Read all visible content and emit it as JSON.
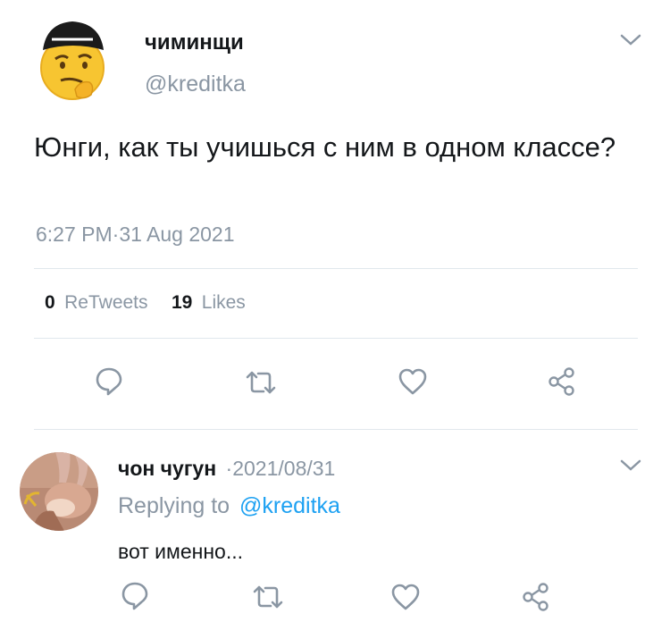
{
  "tweet": {
    "author_name": "чиминщи",
    "author_handle": "@kreditka",
    "text": "Юнги, как ты учишься с ним в одном классе?",
    "time": "6:27 PM",
    "date": "31 Aug 2021",
    "stats": {
      "retweets_count": "0",
      "retweets_label": "ReTweets",
      "likes_count": "19",
      "likes_label": "Likes"
    },
    "actions": [
      "reply-icon",
      "retweet-icon",
      "like-icon",
      "share-icon"
    ]
  },
  "reply": {
    "author_name": "чон чугун",
    "date": "2021/08/31",
    "replying_prefix": "Replying to",
    "replying_handle": "@kreditka",
    "text": "вот именно...",
    "actions": [
      "reply-icon",
      "retweet-icon",
      "like-icon",
      "share-icon"
    ]
  },
  "colors": {
    "text": "#14171a",
    "muted": "#8a96a3",
    "accent": "#1da1f2",
    "divider": "#e1e8ed"
  }
}
